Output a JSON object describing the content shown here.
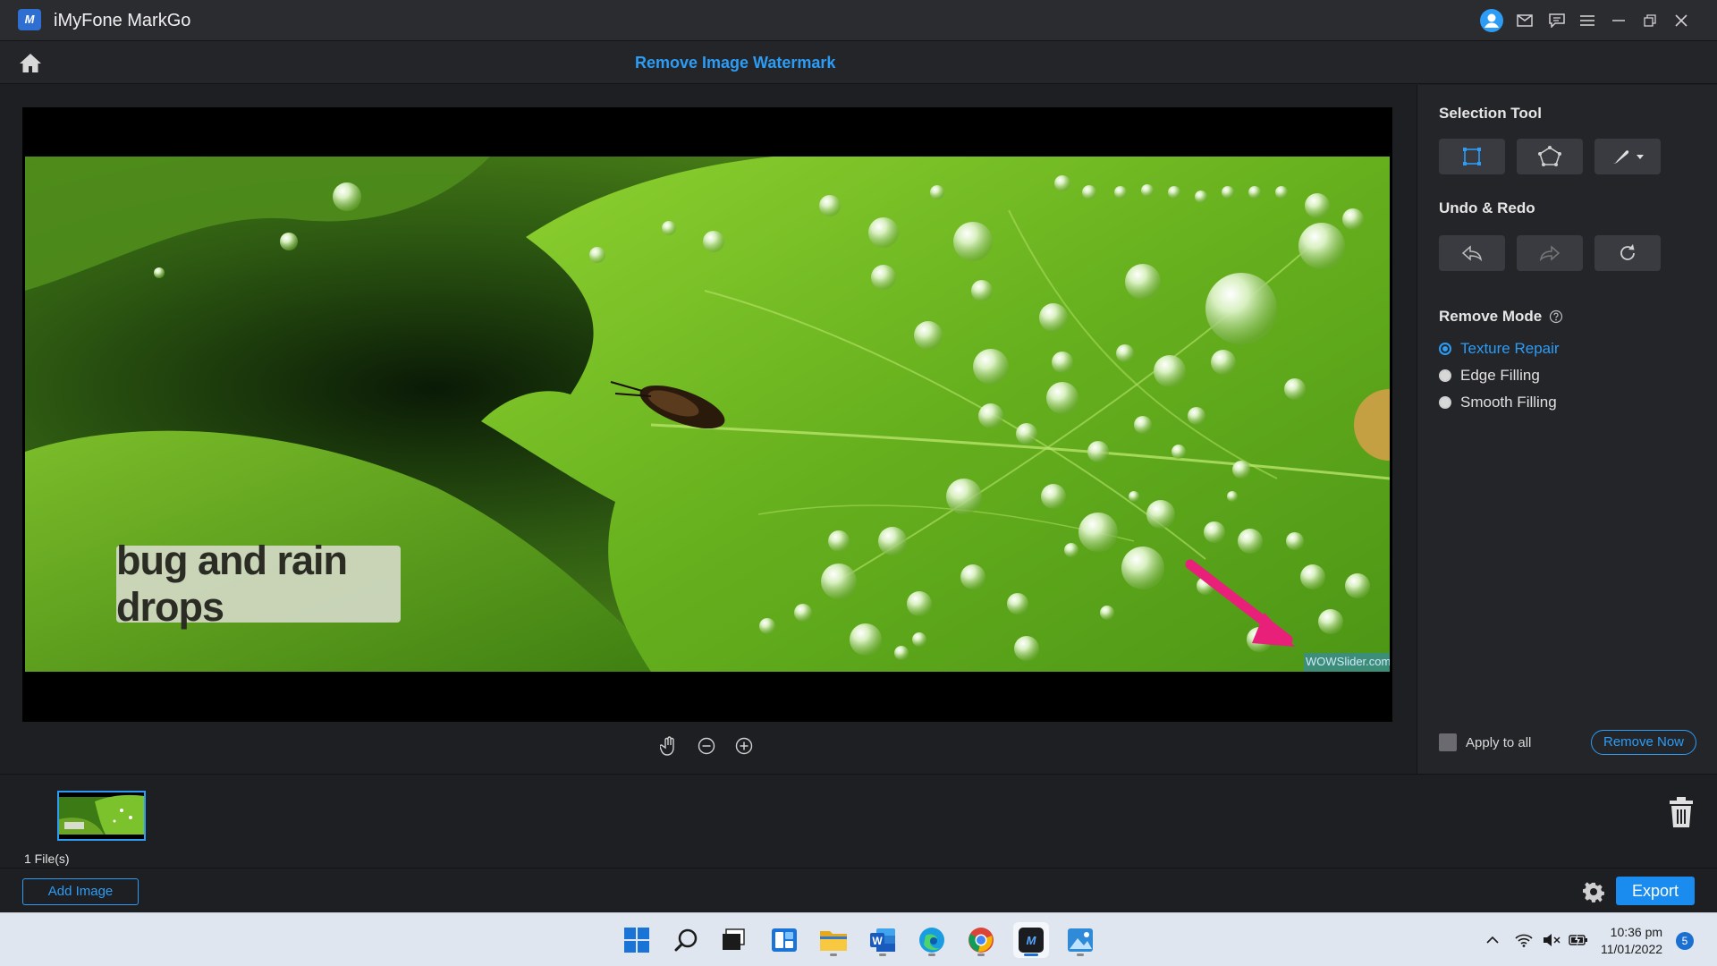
{
  "app": {
    "title": "iMyFone MarkGo",
    "logo_text": "M"
  },
  "header": {
    "page_title": "Remove Image Watermark"
  },
  "image": {
    "caption_text": "bug and rain drops",
    "watermark_text": "WOWSlider.com"
  },
  "side_panel": {
    "selection_tool_title": "Selection Tool",
    "undo_redo_title": "Undo & Redo",
    "remove_mode_title": "Remove Mode",
    "modes": [
      {
        "label": "Texture Repair",
        "selected": true
      },
      {
        "label": "Edge Filling",
        "selected": false
      },
      {
        "label": "Smooth Filling",
        "selected": false
      }
    ],
    "apply_to_all_label": "Apply to all",
    "apply_to_all_checked": false,
    "remove_now_label": "Remove Now"
  },
  "files": {
    "count_label": "1 File(s)"
  },
  "actions": {
    "add_image_label": "Add Image",
    "export_label": "Export"
  },
  "taskbar": {
    "time": "10:36 pm",
    "date": "11/01/2022",
    "notification_count": "5",
    "apps": [
      "start-icon",
      "search-icon",
      "task-view-icon",
      "widgets-icon",
      "file-explorer-icon",
      "word-icon",
      "edge-icon",
      "chrome-icon",
      "markgo-icon",
      "photos-icon"
    ]
  },
  "colors": {
    "accent": "#2d9cf5",
    "background": "#1e1f22",
    "panel": "#242529",
    "arrow": "#e8207a"
  }
}
